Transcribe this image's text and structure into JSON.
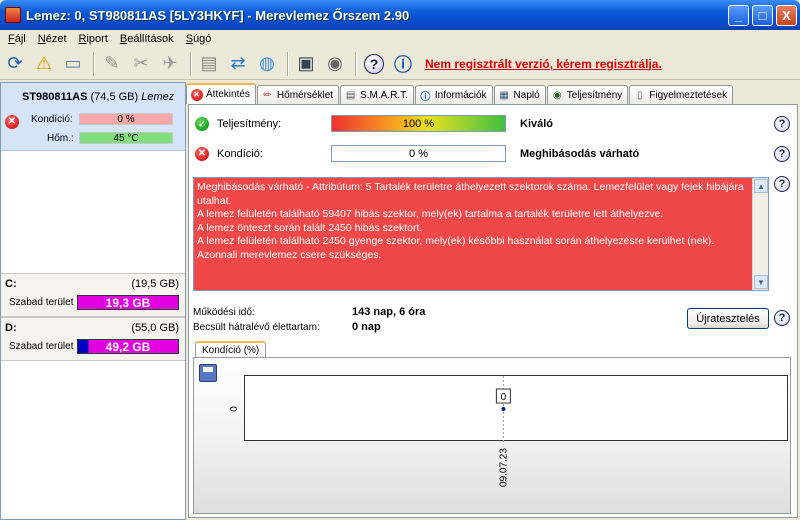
{
  "window": {
    "title": "Lemez: 0, ST980811AS [5LY3HKYF]  -  Merevlemez Őrszem 2.90",
    "minimize": "_",
    "maximize": "□",
    "close": "X"
  },
  "menu": [
    {
      "key": "F",
      "rest": "ájl"
    },
    {
      "key": "N",
      "rest": "ézet"
    },
    {
      "key": "R",
      "rest": "iport"
    },
    {
      "key": "B",
      "rest": "eállítások"
    },
    {
      "key": "S",
      "rest": "úgó"
    }
  ],
  "toolbar": {
    "reg_text": "Nem regisztrált verzió, kérem regisztrálja."
  },
  "left": {
    "disk_name": "ST980811AS",
    "disk_size": "(74,5 GB)",
    "disk_label": "Lemez",
    "health_label": "Kondíció:",
    "health_value": "0 %",
    "temp_label": "Hőm.:",
    "temp_value": "45 °C",
    "volumes": [
      {
        "name": "C:",
        "size": "(19,5 GB)",
        "free_label": "Szabad terület",
        "free_value": "19,3 GB",
        "free_fraction": 0.99
      },
      {
        "name": "D:",
        "size": "(55,0 GB)",
        "free_label": "Szabad terület",
        "free_value": "49,2 GB",
        "free_fraction": 0.894
      }
    ]
  },
  "tabs": [
    {
      "label": "Áttekintés",
      "icon": "red-x-icon",
      "active": true
    },
    {
      "label": "Hőmérséklet",
      "icon": "thermometer-icon",
      "active": false
    },
    {
      "label": "S.M.A.R.T.",
      "icon": "smart-icon",
      "active": false
    },
    {
      "label": "Információk",
      "icon": "info-icon",
      "active": false
    },
    {
      "label": "Napló",
      "icon": "log-icon",
      "active": false
    },
    {
      "label": "Teljesítmény",
      "icon": "performance-icon",
      "active": false
    },
    {
      "label": "Figyelmeztetések",
      "icon": "warnings-icon",
      "active": false
    }
  ],
  "overview": {
    "performance_label": "Teljesítmény:",
    "performance_value": "100 %",
    "performance_fraction": 1.0,
    "performance_rating": "Kiváló",
    "health_label": "Kondíció:",
    "health_value": "0 %",
    "health_fraction": 0.0,
    "health_rating": "Meghibásodás várható",
    "message_lines": [
      "Meghibásodás várható - Attribútum: 5 Tartalék területre áthelyezett szektorok száma. Lemezfelület vagy fejek hibájára utalhat.",
      "A lemez felületén található 59407 hibás szektor, mely(ek) tartalma a tartalék területre lett áthelyezve.",
      "A lemez önteszt során talált 2450 hibás szektort.",
      "A lemez felületén található 2450 gyenge szektor, mely(ek) későbbi használat során áthelyezésre kerülhet (nek).",
      "Azonnali merevlemez csere szükséges."
    ],
    "uptime_label": "Működési idő:",
    "uptime_value": "143 nap, 6 óra",
    "lifetime_label": "Becsült hátralévő élettartam:",
    "lifetime_value": "0 nap",
    "retest_button": "Újratesztelés",
    "chart_tab": "Kondíció  (%)"
  },
  "colors": {
    "health_bad": "#f04848",
    "free_space": "#e000e0",
    "temp_ok": "#80e080"
  },
  "chart_data": {
    "type": "line",
    "x": [
      "09.07.23"
    ],
    "series": [
      {
        "values": [
          0
        ]
      }
    ],
    "ylabel": "",
    "yticks": [
      "0"
    ],
    "data_labels": [
      "0"
    ]
  }
}
